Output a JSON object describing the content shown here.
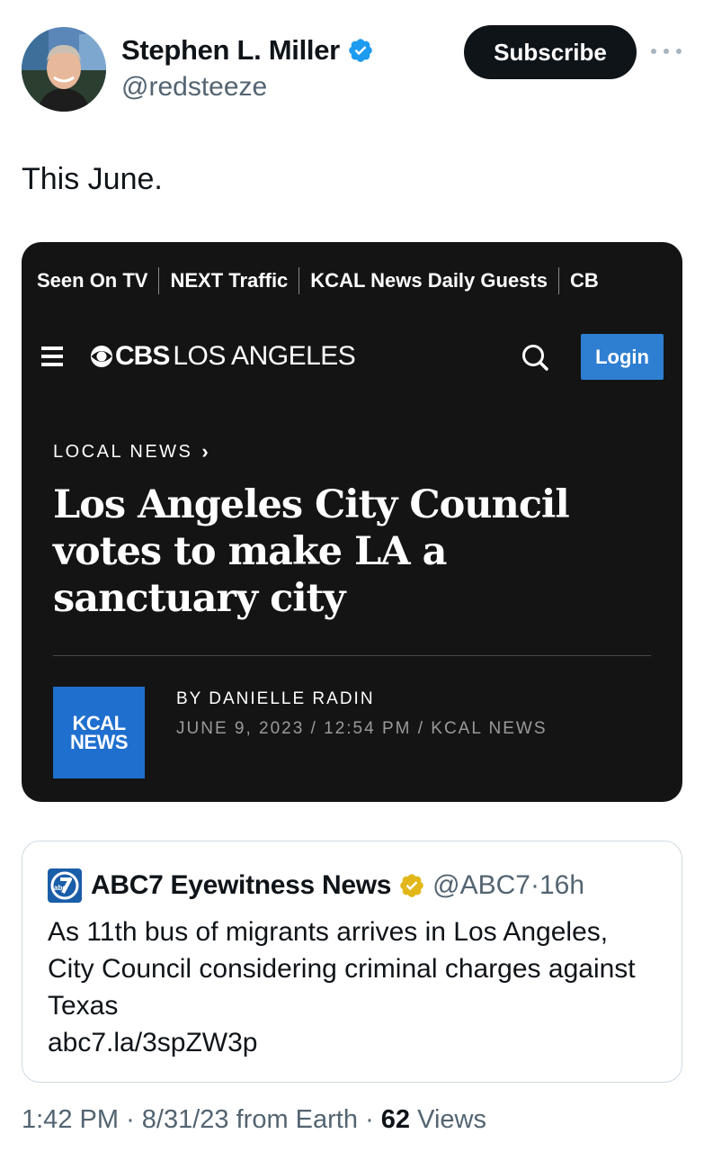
{
  "author": {
    "name": "Stephen L. Miller",
    "handle": "@redsteeze",
    "subscribe_label": "Subscribe"
  },
  "tweet": {
    "text": "This June."
  },
  "article_card": {
    "nav_items": [
      "Seen On TV",
      "NEXT Traffic",
      "KCAL News Daily Guests",
      "CB"
    ],
    "brand": {
      "cbs": "CBS",
      "location": "LOS ANGELES"
    },
    "login_label": "Login",
    "kicker": "LOCAL NEWS",
    "headline": "Los Angeles City Council votes to make LA a sanctuary city",
    "kcal_logo": {
      "line1": "KCAL",
      "line2": "NEWS"
    },
    "byline": "BY DANIELLE RADIN",
    "dateline": "JUNE 9, 2023 / 12:54 PM / KCAL NEWS"
  },
  "quote_tweet": {
    "name": "ABC7 Eyewitness News",
    "handle": "@ABC7",
    "dot": "·",
    "age": "16h",
    "text": "As 11th bus of migrants arrives in Los Angeles, City Council considering criminal charges against Texas",
    "link": "abc7.la/3spZW3p"
  },
  "footer": {
    "time": "1:42 PM",
    "date": "8/31/23",
    "source": "from Earth",
    "sep": "·",
    "views_count": "62",
    "views_label": "Views"
  },
  "colors": {
    "text_primary": "#0f1419",
    "text_secondary": "#536471",
    "verified_blue": "#1d9bf0",
    "verified_gold": "#e2b719",
    "card_bg": "#141414",
    "login_blue": "#2e7fd1",
    "kcal_blue": "#1f6fce"
  }
}
